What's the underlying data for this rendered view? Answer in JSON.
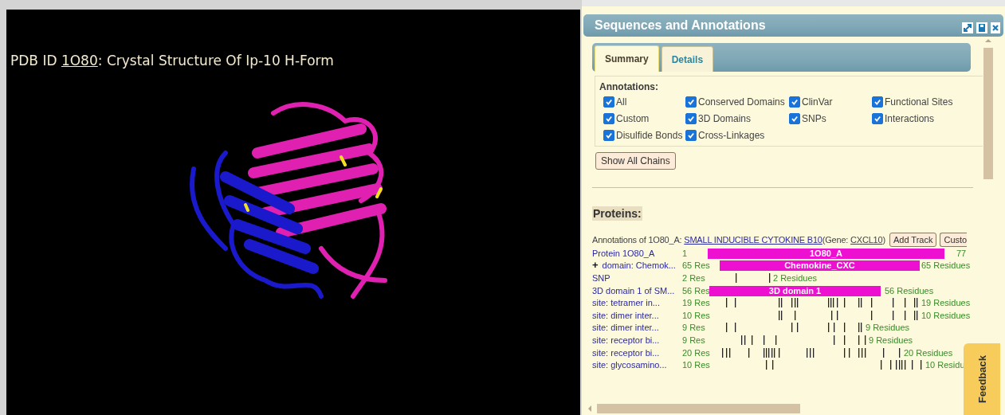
{
  "viewer": {
    "title_prefix": "PDB ID ",
    "pdb_id": "1O80",
    "title_suffix": ": Crystal Structure Of Ip-10 H-Form"
  },
  "panel": {
    "title": "Sequences and Annotations"
  },
  "tabs": [
    {
      "label": "Summary",
      "selected": true
    },
    {
      "label": "Details",
      "selected": false
    }
  ],
  "annotations": {
    "heading": "Annotations:",
    "options": [
      {
        "label": "All",
        "checked": true
      },
      {
        "label": "Conserved Domains",
        "checked": true
      },
      {
        "label": "ClinVar",
        "checked": true
      },
      {
        "label": "Functional Sites",
        "checked": true
      },
      {
        "label": "Custom",
        "checked": true
      },
      {
        "label": "3D Domains",
        "checked": true
      },
      {
        "label": "SNPs",
        "checked": true
      },
      {
        "label": "Interactions",
        "checked": true
      },
      {
        "label": "Disulfide Bonds",
        "checked": true
      },
      {
        "label": "Cross-Linkages",
        "checked": true
      }
    ]
  },
  "show_all_chains": "Show All Chains",
  "proteins": {
    "heading": "Proteins:",
    "annotations_prefix": "Annotations of 1O80_A: ",
    "protein_link": "SMALL INDUCIBLE CYTOKINE B10",
    "gene_prefix": "(Gene: ",
    "gene_link": "CXCL10",
    "gene_suffix": ")",
    "buttons": [
      "Add Track",
      "Custo"
    ]
  },
  "tracks": [
    {
      "kind": "bar",
      "label": "Protein 1O80_A",
      "count": "1",
      "bar_label": "1O80_A",
      "end_label": "77"
    },
    {
      "kind": "bar",
      "expand": "+",
      "label": "domain: Chemok...",
      "count": "65 Res",
      "bar_label": "Chemokine_CXC",
      "end_label": "65 Residues"
    },
    {
      "kind": "ticks",
      "label": "SNP",
      "count": "2 Res",
      "end_label": "2 Residues"
    },
    {
      "kind": "bar",
      "label": "3D domain 1 of SM...",
      "count": "56 Res",
      "bar_label": "3D domain 1",
      "end_label": "56 Residues"
    },
    {
      "kind": "ticks",
      "label": "site: tetramer in...",
      "count": "19 Res",
      "end_label": "19 Residues"
    },
    {
      "kind": "ticks",
      "label": "site: dimer inter...",
      "count": "10 Res",
      "end_label": "10 Residues"
    },
    {
      "kind": "ticks",
      "label": "site: dimer inter...",
      "count": "9 Res",
      "end_label": "9 Residues"
    },
    {
      "kind": "ticks",
      "label": "site: receptor bi...",
      "count": "9 Res",
      "end_label": "9 Residues"
    },
    {
      "kind": "ticks",
      "label": "site: receptor bi...",
      "count": "20 Res",
      "end_label": "20 Residues"
    },
    {
      "kind": "ticks",
      "label": "site: glycosamino...",
      "count": "10 Res",
      "end_label": "10 Residu"
    }
  ],
  "feedback": "Feedback"
}
